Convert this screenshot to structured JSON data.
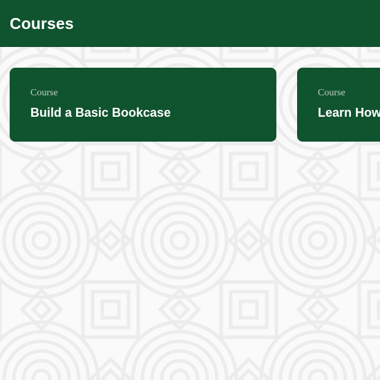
{
  "header": {
    "title": "Courses"
  },
  "colors": {
    "header_bg": "#10532f",
    "card_bg": "#10532f",
    "page_bg": "#fafafa",
    "kicker_text": "#c3d2c8"
  },
  "courses": [
    {
      "kicker": "Course",
      "title": "Build a Basic Bookcase"
    },
    {
      "kicker": "Course",
      "title": "Learn How"
    }
  ]
}
